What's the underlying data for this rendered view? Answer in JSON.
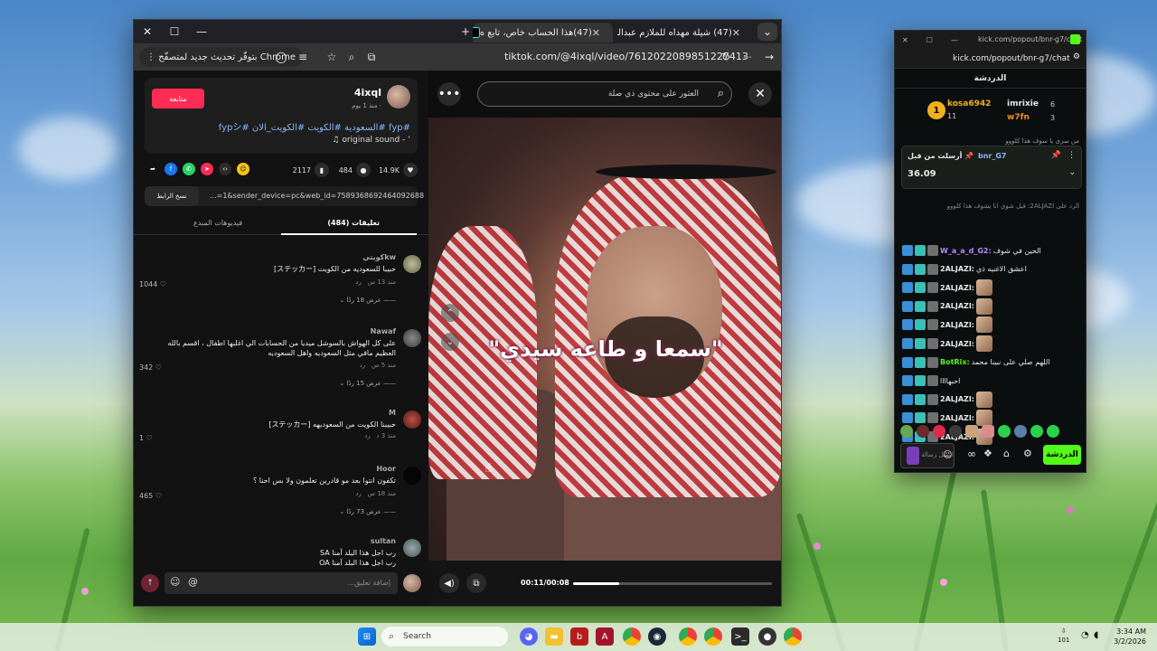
{
  "browser": {
    "tabs": [
      {
        "label": "(47) شيلة مهداه للملازم عبدالله ت",
        "active": false
      },
      {
        "label": "(47)هذا الحساب خاص، تابع ه",
        "active": true
      }
    ],
    "new_tab": "+",
    "dropdown": "⌄",
    "chrome_update": "بتوفّر تحديث جديد لمتصفّح Chrome",
    "url": "tiktok.com/@4ixql/video/7612022089851227413"
  },
  "tiktok": {
    "creator": {
      "name": "4ixql",
      "sub": "· منذ 1 يوم",
      "follow": "متابعة",
      "caption": "#fyp #السعودية #الكويت #الكويت_الان #fypシ",
      "sound": "♫ original sound - ’"
    },
    "stats": {
      "likes": "14.9K",
      "comments": "484",
      "saves": "2117"
    },
    "link": {
      "text": "...=1&sender_device=pc&web_id=7589368692464092688",
      "copy": "نسخ الرابط"
    },
    "tabs": {
      "comments": "تعليقات (484)",
      "creator_videos": "فيديوهات المبدع"
    },
    "comments": [
      {
        "user": "كويتيkw",
        "text": "حبيبا للسعوديه من الكويت [ステッカー]",
        "time": "منذ 13 س",
        "reply": "رد",
        "likes": "1044",
        "replies": "عرض 18 ردًا"
      },
      {
        "user": "Nawaf",
        "text": "على كل الهواش بالسوشل ميديا من الحسابات الي اغلبها اطفال ، اقسم بالله العظيم مافي مثل السعوديه واهل السعوديه",
        "time": "منذ 5 س",
        "reply": "رد",
        "likes": "342",
        "replies": "عرض 15 ردًا"
      },
      {
        "user": "M",
        "text": "حبيبنا الكويت من السعوديهه [ステッカー]",
        "time": "منذ 3 د",
        "reply": "رد",
        "likes": "1",
        "replies": ""
      },
      {
        "user": "Hoor",
        "text": "تكفون انتوا بعد مو قادرين تعلمون ولا بس احنا ؟",
        "time": "منذ 18 س",
        "reply": "رد",
        "likes": "465",
        "replies": "عرض 73 ردًا"
      },
      {
        "user": "sultan",
        "text": "رب اجل هذا البلد آمنا SA\nرب اجل هذا البلد آمنا OA",
        "time": "",
        "reply": "",
        "likes": "",
        "replies": ""
      }
    ],
    "comment_placeholder": "إضافة تعليق...",
    "search_placeholder": "العثور على محتوى ذي صلة",
    "video_caption": "\"سمعا و طاعه سيدي\"",
    "time": "00:11/00:08",
    "progress": 0.23
  },
  "kick": {
    "window_url": "kick.com/popout/bnr-g7/chat",
    "addr_url": "kick.com/popout/bnr-g7/chat",
    "header": "الدردشة",
    "leaderboard": [
      {
        "rank": "1",
        "name": "kosa6942",
        "count": "11"
      },
      {
        "rank": "",
        "name": "imrixie",
        "count": "6"
      },
      {
        "rank": "",
        "name": "w7fn",
        "count": "3"
      }
    ],
    "pinned": {
      "label": "أرسلت من قبل",
      "user": "bnr_G7",
      "value": "36.09"
    },
    "reply_hint": "الرد على 2ALJAZI: قبل شوي انا يشوف هذا كلووو",
    "top_cut": "من سرى يا سوف هذا كلووو",
    "messages": [
      {
        "user": "W_a_a_d_G2:",
        "text": "الحين في شوف",
        "emote": false
      },
      {
        "user": "2ALJAZI:",
        "text": "اعشق الاغنيه ذي",
        "emote": false
      },
      {
        "user": "2ALJAZI:",
        "text": "",
        "emote": true
      },
      {
        "user": "2ALJAZI:",
        "text": "",
        "emote": true
      },
      {
        "user": "2ALJAZI:",
        "text": "",
        "emote": true
      },
      {
        "user": "2ALJAZI:",
        "text": "",
        "emote": true
      },
      {
        "user": "BotRix:",
        "text": "اللهم صلي على نبينا محمد",
        "emote": false
      },
      {
        "user": "",
        "text": "احبهاااا",
        "emote": false
      },
      {
        "user": "2ALJAZI:",
        "text": "",
        "emote": true
      },
      {
        "user": "2ALJAZI:",
        "text": "",
        "emote": true
      },
      {
        "user": "2ALJAZI:",
        "text": "",
        "emote": true
      }
    ],
    "chat_button": "الدردشة",
    "send_hint": "ارسل رسالة"
  },
  "taskbar": {
    "search": "Search",
    "time": "3:34 AM",
    "date": "3/2/2026",
    "lang": "101"
  },
  "colors": {
    "tiktok_red": "#fe2c55",
    "kick_green": "#53fc18"
  }
}
